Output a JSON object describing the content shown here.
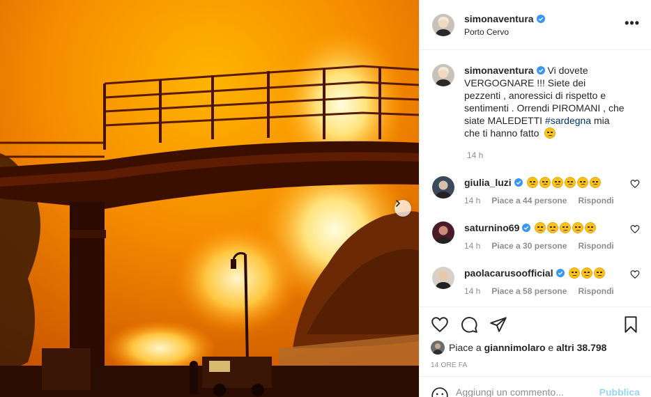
{
  "post": {
    "username": "simonaventura",
    "location": "Porto Cervo",
    "more_label": "•••",
    "caption": {
      "username": "simonaventura",
      "text_before": " Vi dovete VERGOGNARE !!! Siete dei pezzenti , anoressici di rispetto e sentimenti . Orrendi PIROMANI , che siate MALEDETTI ",
      "hashtag": "#sardegna",
      "text_after": " mia che ti hanno fatto",
      "time": "14 h"
    },
    "comments": [
      {
        "username": "giulia_luzi",
        "emoji_count": 6,
        "emoji": "disappointed-face",
        "time": "14 h",
        "likes": "Piace a 44 persone",
        "reply": "Rispondi"
      },
      {
        "username": "saturnino69",
        "emoji_count": 5,
        "emoji": "frowning-face",
        "time": "14 h",
        "likes": "Piace a 30 persone",
        "reply": "Rispondi"
      },
      {
        "username": "paolacarusoofficial",
        "emoji_count": 3,
        "emoji": "frowning-face",
        "time": "14 h",
        "likes": "Piace a 58 persone",
        "reply": "Rispondi"
      }
    ],
    "likes": {
      "prefix": "Piace a ",
      "user": "giannimolaro",
      "middle": " e ",
      "others": "altri 38.798"
    },
    "timestamp": "14 ORE FA",
    "add_comment": {
      "placeholder": "Aggiungi un commento...",
      "publish": "Pubblica"
    }
  },
  "colors": {
    "verified": "#3897f0",
    "fire_orange": "#f07a00",
    "fire_yellow": "#ffd84a"
  }
}
